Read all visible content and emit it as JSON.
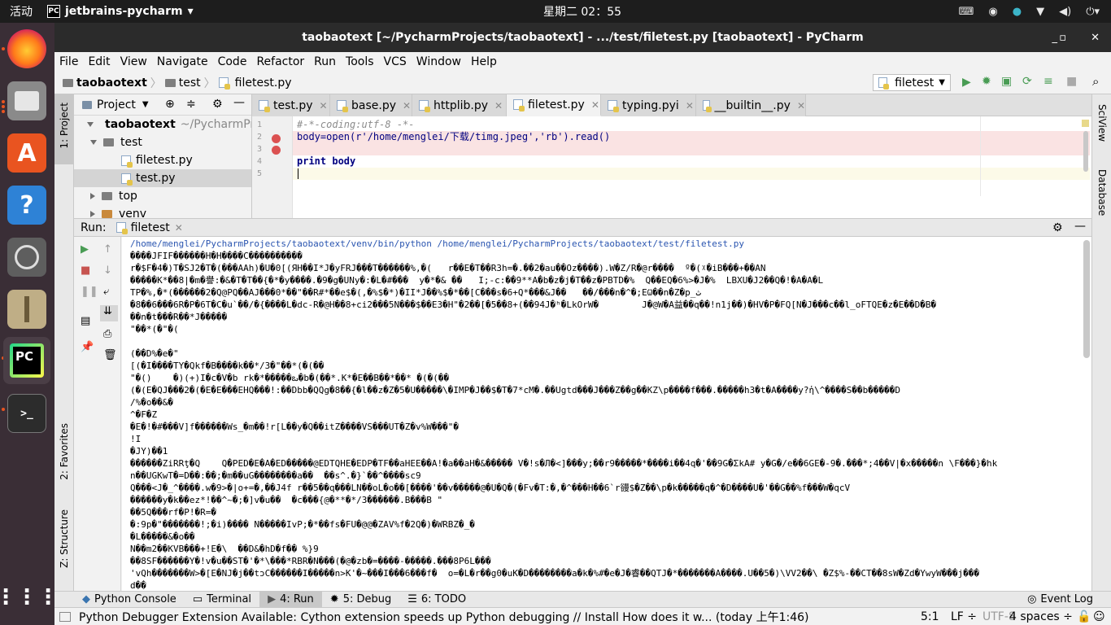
{
  "topbar": {
    "activities": "活动",
    "app_name": "jetbrains-pycharm",
    "clock": "星期二 02：55"
  },
  "window": {
    "title": "taobaotext [~/PycharmProjects/taobaotext] - .../test/filetest.py [taobaotext] - PyCharm"
  },
  "menu": [
    "File",
    "Edit",
    "View",
    "Navigate",
    "Code",
    "Refactor",
    "Run",
    "Tools",
    "VCS",
    "Window",
    "Help"
  ],
  "breadcrumb": [
    "taobaotext",
    "test",
    "filetest.py"
  ],
  "run_config": "filetest",
  "left_tools": {
    "project": "1: Project",
    "favorites": "2: Favorites",
    "structure": "Z: Structure"
  },
  "right_tools": {
    "sciview": "SciView",
    "database": "Database"
  },
  "project_panel": {
    "title": "Project",
    "tree": [
      {
        "label": "taobaotext",
        "suffix": "~/PycharmProj"
      },
      {
        "label": "test"
      },
      {
        "label": "filetest.py"
      },
      {
        "label": "test.py"
      },
      {
        "label": "top"
      },
      {
        "label": "venv"
      }
    ]
  },
  "editor_tabs": [
    "test.py",
    "base.py",
    "httplib.py",
    "filetest.py",
    "typing.pyi",
    "__builtin__.py"
  ],
  "editor": {
    "line_numbers": [
      "1",
      "2",
      "3",
      "4",
      "5"
    ],
    "lines": [
      "#-*-coding:utf-8 -*-",
      "body=open(r'/home/menglei/下载/timg.jpeg','rb').read()",
      "",
      "print body",
      ""
    ]
  },
  "run_panel": {
    "label": "Run:",
    "tab": "filetest"
  },
  "console": [
    "/home/menglei/PycharmProjects/taobaotext/venv/bin/python /home/menglei/PycharmProjects/taobaotext/test/filetest.py",
    "����JFIF������H�H����C����������",
    "r�$F�4�)T�SJ2�T�(���AAh)�U�0[(ЯH��I*J�yFRJ���T������%,�(   r��E�T��R3h=�.��2�au��Oz����).W�Z/R�@r����  º�(ᵡ�iB���+��AN",
    "�����K*��8|�m�譽:�&�T�T��{�*�y����.�9�g�UNy�:�L�#���  y�*�& ��   I;-c:��9**A�b�z�j�T��z�PBTD�%  Q��EQ�6%>�J�%  LBXU�J2��Q�!�A�A�L",
    "TP�%,�*(������2�Q@PQ��AJ���0*��\"��R#*��e$�(,�%$�*)�II*J��%$�*��[C���s�6+Q*���&J��   ��/���n�^�;EѠ��n�Z�p_ث",
    "�8��6���6R�P�6T�C�u`��/�{����L�dc-R�@H��8+ci2���5N���$��E3�H\"�2��[�5��8+(��94J�ʰ�LkOrW�        J�@W�A益��q��!n1j��)�HV�P�FQ[N�J���c��l_oFTQE�z�E��D�B�",
    "��n�t���R��*J�����",
    "\"��*(�\"�(",
    "",
    "(��D%�e�\"",
    "[(�I����TY�Qkf�B����k��*/3�\"��*(�(��",
    "\"�()    �)(+)I�c�V�b rk�*�����ఒ�b�(��*.K*�E��B��*��* �(�(��",
    "(�(E�QJ���2�(�E�E���EHQ���!:��Dbb�QQg�8��{�l��z�Z�5�U�����\\�IMP�J��$�T�7*cM�.��Ugtd���J���Z��g��KZ\\p����f���.�����h3�t�A����y?ἡ\\^����S��b�����D",
    "/%�o��&�",
    "^�F�Z",
    "�E�!�#���V]f������Ws_�m��!r[L��y�Q��itZ����VS���UT�Z�v%W���\"�",
    "!I",
    "�JY)��1",
    "������ZiRRţ�Q    Q�PED�E�A�ED�����@EDTQHE�EDP�TF��aHEE��A!�a��aH�&����� V�!s�Л�<]���y;��r9�����*����i��4q�'��9G�ΣkA# y�G�/e��6GE�-9�.���*;4��V|�x�����n \\F���}�hk",
    "n��UGKwT�=D��:��;�m��uG��������a��  ��s^.�}`��^����sc9",
    "Q���<J�_^����.w�9>�|o+=�,��J4f r��5��q���LN��oL�o��[����'��v�����@�U�Q�(�Fv�T:�,�^���H��6`r䜱$�Z��\\p�k�����q�^�D����U�'��G��%f���W�qcV",
    "������y�k��ez*!��^~�;�]v�u��  �c���{@�**�*/3������.B���B \"",
    "��5Q���rf�P!�R=�",
    "�:9p�\"�������!;�i)���� N�����IvP;�*��fs�FU�@@�ZAV%f�2Q�)�WRBZ�_�",
    "�L�����&�o��",
    "N��m2��KVB���+!E�\\  ��D&�hD�f�� %}9",
    "��8SF������Y�!v�u��ST�'�*\\���*RBR�N���(�@�zb�=����-�����.���8P6L���",
    "'vQh�������W>�[E�NJ�j��tɔC������I�����n>K'�~���I���6���f�  o=�L�r��g0�uK�D��������a�k�%#�e�J�睿��QTJ�*�������A����.U��5�)\\VV2��\\ �Z$%-��CT��8sW�Zd�YwyW���j���",
    "d��"
  ],
  "bottom_tools": [
    "Python Console",
    "Terminal",
    "4: Run",
    "5: Debug",
    "6: TODO"
  ],
  "event_log": "Event Log",
  "status": {
    "message": "Python Debugger Extension Available: Cython extension speeds up Python debugging // Install How does it w... (today 上午1:46)",
    "position": "5:1",
    "line_sep": "LF ÷",
    "encoding": "UTF-8",
    "indent": "4 spaces ÷"
  }
}
